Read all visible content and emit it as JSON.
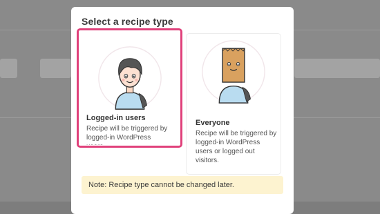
{
  "modal": {
    "title": "Select a recipe type",
    "note": "Note: Recipe type cannot be changed later."
  },
  "cards": [
    {
      "title": "Logged-in users",
      "desc": "Recipe will be triggered by logged-in WordPress users.",
      "illustration": "user-avatar-icon",
      "selected": true
    },
    {
      "title": "Everyone",
      "desc": "Recipe will be triggered by logged-in WordPress users or logged out visitors.",
      "illustration": "paper-bag-head-icon",
      "selected": false
    }
  ],
  "colors": {
    "selected_border": "#e0417b",
    "note_background": "#fdf3d0",
    "overlay": "#8a8a8a"
  }
}
